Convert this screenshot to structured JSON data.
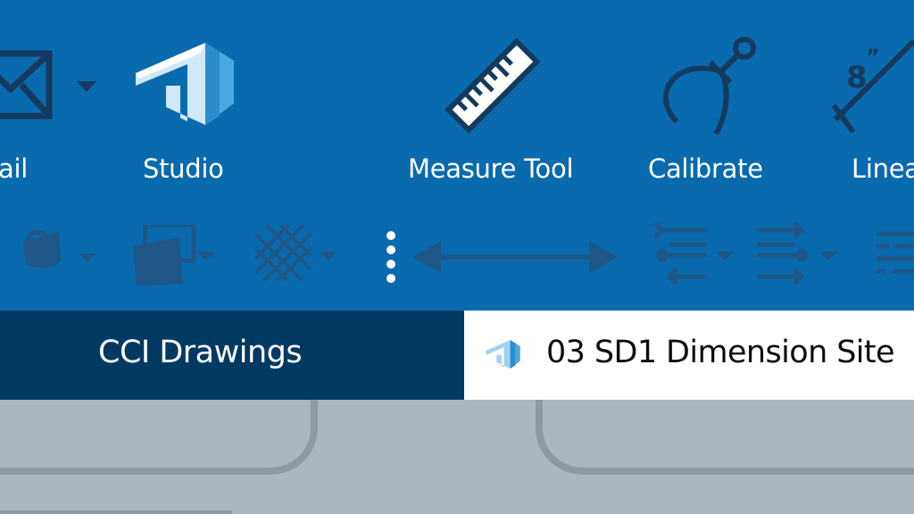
{
  "ribbon": {
    "tools": [
      {
        "id": "email",
        "label": "ail",
        "icon": "envelope-icon"
      },
      {
        "id": "studio",
        "label": "Studio",
        "icon": "studio-icon"
      },
      {
        "id": "measure",
        "label": "Measure Tool",
        "icon": "ruler-icon"
      },
      {
        "id": "calibrate",
        "label": "Calibrate",
        "icon": "caliper-icon"
      },
      {
        "id": "linear",
        "label": "Linea",
        "icon": "linear-dimension-icon"
      }
    ],
    "small_icons": [
      "mug-icon",
      "image-stack-icon",
      "hatch-pattern-icon",
      "vertical-dots-icon",
      "double-arrow-icon",
      "align-left-icon",
      "align-right-icon",
      "list-lines-icon"
    ]
  },
  "tabs": [
    {
      "label": "CCI Drawings",
      "active": false
    },
    {
      "label": "03 SD1 Dimension Site",
      "active": true,
      "icon": "studio-icon"
    }
  ],
  "colors": {
    "ribbon": "#0a6aae",
    "icon_dark": "#143a5f",
    "icon_muted": "#1f5788",
    "tab_inactive": "#003a63",
    "tab_active": "#ffffff",
    "canvas": "#aab6bf"
  }
}
